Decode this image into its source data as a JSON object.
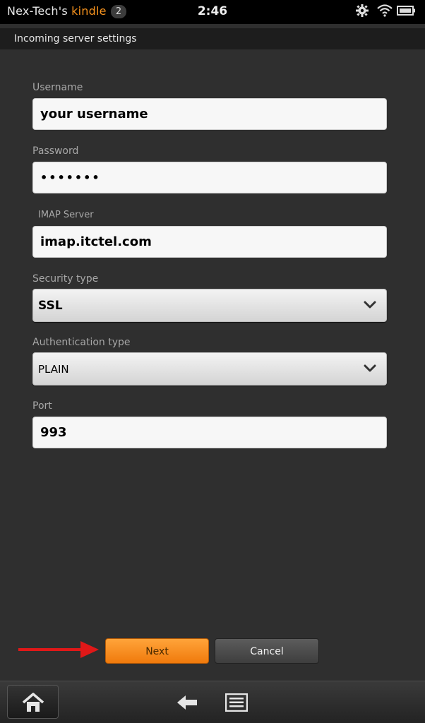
{
  "status_bar": {
    "carrier": "Nex-Tech's",
    "brand": "kindle",
    "notification_count": "2",
    "time": "2:46",
    "icons": [
      "gear-icon",
      "wifi-icon",
      "battery-icon"
    ]
  },
  "header": {
    "title": "Incoming server settings"
  },
  "form": {
    "username": {
      "label": "Username",
      "value": "your username"
    },
    "password": {
      "label": "Password",
      "value": "•••••••"
    },
    "imap_server": {
      "label": "IMAP Server",
      "value": "imap.itctel.com"
    },
    "security_type": {
      "label": "Security type",
      "value": "SSL"
    },
    "auth_type": {
      "label": "Authentication type",
      "value": "PLAIN"
    },
    "port": {
      "label": "Port",
      "value": "993"
    }
  },
  "actions": {
    "next_label": "Next",
    "cancel_label": "Cancel"
  },
  "nav": {
    "icons": [
      "home-icon",
      "back-icon",
      "menu-icon"
    ]
  },
  "colors": {
    "accent": "#f7931e",
    "background": "#2f2f2f",
    "annotation_arrow": "#e01818"
  }
}
